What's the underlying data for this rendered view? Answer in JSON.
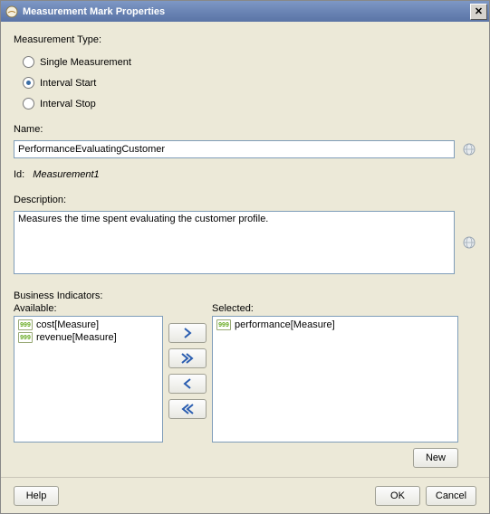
{
  "title": "Measurement Mark Properties",
  "measurementType": {
    "label": "Measurement Type:",
    "options": [
      "Single Measurement",
      "Interval Start",
      "Interval Stop"
    ],
    "selected": 1
  },
  "name": {
    "label": "Name:",
    "value": "PerformanceEvaluatingCustomer"
  },
  "id": {
    "label": "Id:",
    "value": "Measurement1"
  },
  "description": {
    "label": "Description:",
    "value": "Measures the time spent evaluating the customer profile."
  },
  "businessIndicators": {
    "label": "Business Indicators:",
    "availableLabel": "Available:",
    "selectedLabel": "Selected:",
    "available": [
      "cost[Measure]",
      "revenue[Measure]"
    ],
    "selected": [
      "performance[Measure]"
    ]
  },
  "buttons": {
    "new": "New",
    "help": "Help",
    "ok": "OK",
    "cancel": "Cancel"
  }
}
